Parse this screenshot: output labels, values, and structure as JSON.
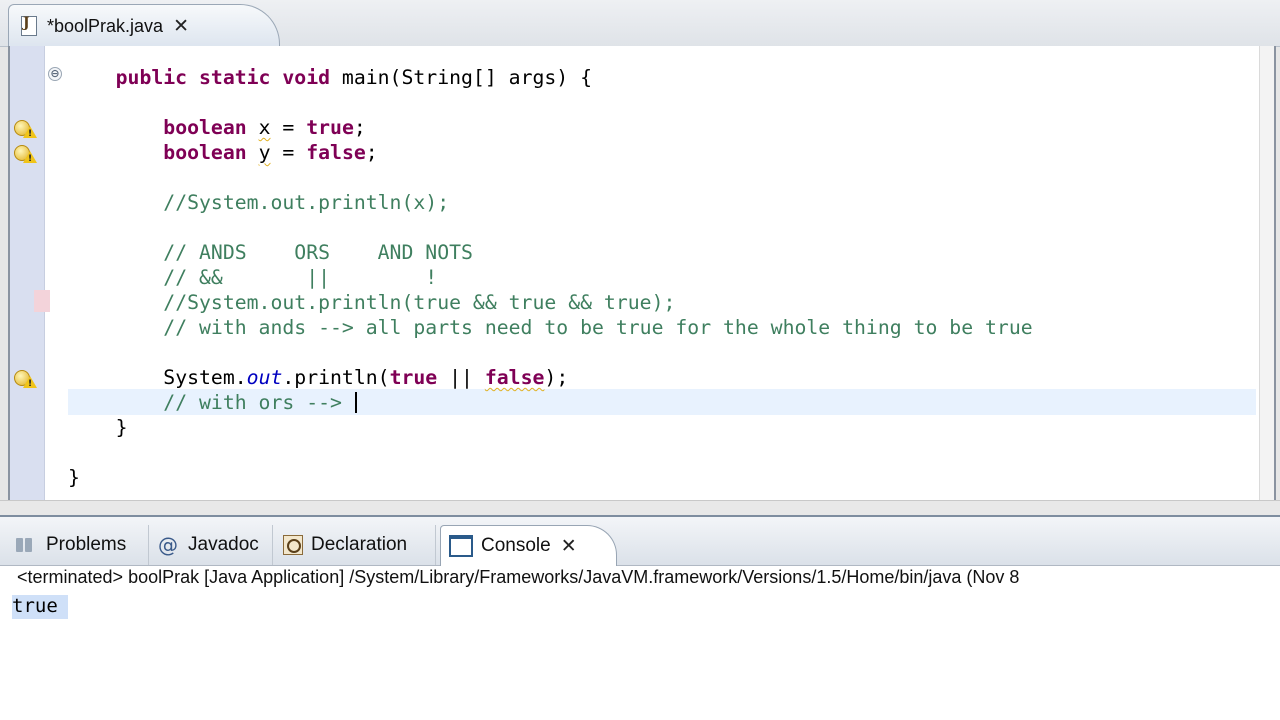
{
  "editor": {
    "tab": {
      "title": "*boolPrak.java",
      "icon": "java-file-icon"
    },
    "code": {
      "l1": {
        "indent": "    ",
        "kw1": "public static void",
        "rest": " main(String[] args) {"
      },
      "l2": {
        "indent": "        ",
        "kw": "boolean",
        "sp": " ",
        "var": "x",
        "eq": " = ",
        "val": "true",
        "end": ";"
      },
      "l3": {
        "indent": "        ",
        "kw": "boolean",
        "sp": " ",
        "var": "y",
        "eq": " = ",
        "val": "false",
        "end": ";"
      },
      "l4": {
        "indent": "        ",
        "comment": "//System.out.println(x);"
      },
      "l5": {
        "indent": "        ",
        "comment": "// ANDS    ORS    AND NOTS"
      },
      "l6": {
        "indent": "        ",
        "comment": "// &&       ||        !"
      },
      "l7": {
        "indent": "        ",
        "comment": "//System.out.println(true && true && true);"
      },
      "l8": {
        "indent": "        ",
        "comment": "// with ands --> all parts need to be true for the whole thing to be true"
      },
      "l9": {
        "indent": "        ",
        "pre": "System.",
        "field": "out",
        "mid": ".println(",
        "kw1": "true",
        "op": " || ",
        "kw2": "false",
        "end": ");"
      },
      "l10": {
        "indent": "        ",
        "comment": "// with ors --> "
      },
      "l11": {
        "indent": "    ",
        "brace": "}"
      },
      "l12": {
        "indent": "",
        "brace": "}"
      }
    },
    "fold_symbol": "⊖"
  },
  "console": {
    "tabs": [
      {
        "label": "Problems",
        "icon": "problems-icon"
      },
      {
        "label": "Javadoc",
        "icon": "at-icon"
      },
      {
        "label": "Declaration",
        "icon": "declaration-icon"
      },
      {
        "label": "Console",
        "icon": "console-icon",
        "active": true
      }
    ],
    "close_symbol": "✕",
    "status": "<terminated> boolPrak [Java Application] /System/Library/Frameworks/JavaVM.framework/Versions/1.5/Home/bin/java (Nov 8",
    "output": "true"
  }
}
